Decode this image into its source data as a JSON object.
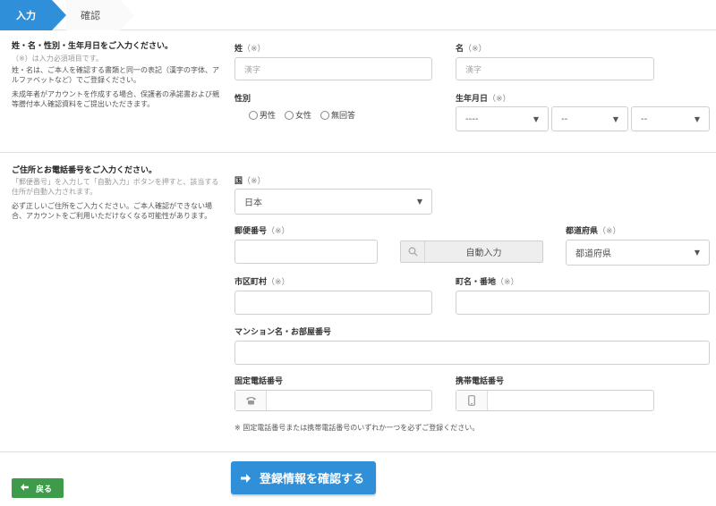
{
  "steps": {
    "input": "入力",
    "confirm": "確認"
  },
  "section1": {
    "title": "姓・名・性別・生年月日をご入力ください。",
    "note_required": "（※）は入力必須項目です。",
    "note1": "姓・名は、ご本人を確認する書類と同一の表記（漢字の字体、アルファベットなど）でご登録ください。",
    "note2": "未成年者がアカウントを作成する場合、保護者の承諾書および親等謄付本人確認資料をご提出いただきます。"
  },
  "fields": {
    "last_name": {
      "label": "姓",
      "req": "（※）",
      "placeholder": "漢字"
    },
    "first_name": {
      "label": "名",
      "req": "（※）",
      "placeholder": "漢字"
    },
    "gender": {
      "label": "性別",
      "options": [
        "男性",
        "女性",
        "無回答"
      ]
    },
    "birthdate": {
      "label": "生年月日",
      "req": "（※）",
      "year": "----",
      "month": "--",
      "day": "--"
    }
  },
  "section2": {
    "title": "ご住所とお電話番号をご入力ください。",
    "note_gray": "「郵便番号」を入力して「自動入力」ボタンを押すと、該当する住所が自動入力されます。",
    "note": "必ず正しいご住所をご入力ください。ご本人確認ができない場合、アカウントをご利用いただけなくなる可能性があります。"
  },
  "address": {
    "country": {
      "label": "国",
      "req": "（※）",
      "value": "日本"
    },
    "postal": {
      "label": "郵便番号",
      "req": "（※）"
    },
    "auto_button": "自動入力",
    "prefecture": {
      "label": "都道府県",
      "req": "（※）",
      "value": "都道府県"
    },
    "city": {
      "label": "市区町村",
      "req": "（※）"
    },
    "street": {
      "label": "町名・番地",
      "req": "（※）"
    },
    "building": {
      "label": "マンション名・お部屋番号"
    },
    "landline": {
      "label": "固定電話番号"
    },
    "mobile": {
      "label": "携帯電話番号"
    },
    "phone_note": "※ 固定電話番号または携帯電話番号のいずれか一つを必ずご登録ください。"
  },
  "buttons": {
    "back": "戻る",
    "confirm": "登録情報を確認する"
  }
}
